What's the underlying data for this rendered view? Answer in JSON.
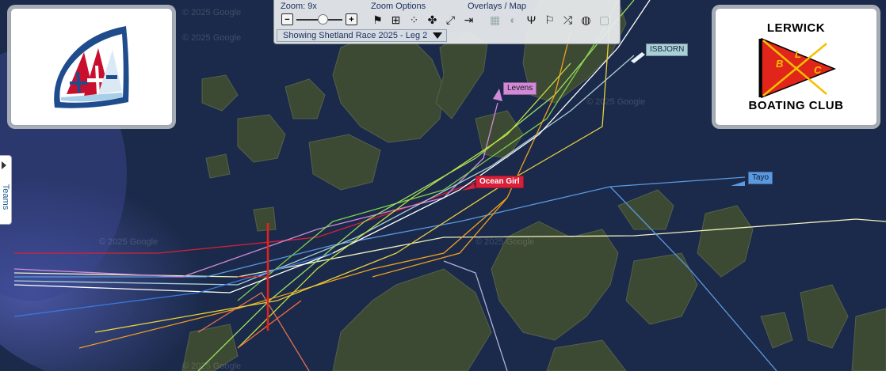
{
  "toolbar": {
    "zoom_label": "Zoom: 9x",
    "zoom_options_label": "Zoom Options",
    "overlays_label": "Overlays / Map",
    "zoom_out": "−",
    "zoom_in": "+",
    "zoom_level": 9,
    "race_selector": "Showing Shetland Race 2025 - Leg 2",
    "zoom_option_icons": [
      "flag-checkered-icon",
      "zoom-fit-icon",
      "boat-dots-icon",
      "fleet-icon",
      "fullscreen-icon",
      "exit-icon"
    ],
    "overlay_icons": [
      "grid-icon",
      "shade-icon",
      "split-icon",
      "wind-icon",
      "shuffle-icon",
      "globe-icon",
      "layer-icon"
    ]
  },
  "left_logo": {
    "name": "norwegian-sail-logo",
    "colors": {
      "shield_blue": "#1f4c8c",
      "light_blue": "#a8cfe8",
      "red": "#c8102e"
    }
  },
  "right_logo": {
    "title_top": "LERWICK",
    "title_bottom": "BOATING CLUB",
    "flag_letters": [
      "B",
      "L",
      "C"
    ],
    "colors": {
      "flag": "#e1251b",
      "cross": "#f5c000",
      "text": "#000000"
    }
  },
  "sidebar": {
    "teams_label": "Teams"
  },
  "boats": [
    {
      "name": "ISBJORN",
      "bg": "#a9cfd8",
      "fg": "#1a2a3a"
    },
    {
      "name": "Levens",
      "bg": "#d28ad8",
      "fg": "#1a1a1a"
    },
    {
      "name": "Ocean Girl",
      "bg": "#d8203a",
      "fg": "#ffffff"
    },
    {
      "name": "Tayo",
      "bg": "#5b9ae0",
      "fg": "#0a1a3a"
    }
  ],
  "map": {
    "copyright": "© 2025 Google",
    "colors": {
      "sea": "#1b2a4a",
      "land": "#3e4a32",
      "start_line": "#e8201a"
    }
  }
}
